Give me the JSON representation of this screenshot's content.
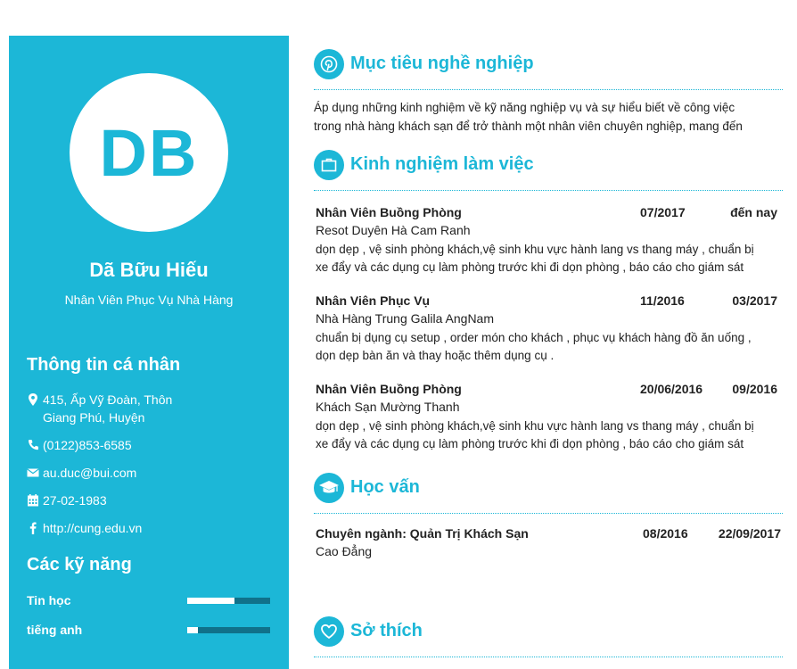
{
  "profile": {
    "initials": "DB",
    "name": "Dã Bữu Hiếu",
    "position": "Nhân Viên Phục Vụ Nhà Hàng"
  },
  "personal_info": {
    "heading": "Thông tin cá nhân",
    "address_line1": "415, Ấp Vỹ Đoàn, Thôn",
    "address_line2": "Giang Phú, Huyện",
    "phone": "(0122)853-6585",
    "email": "au.duc@bui.com",
    "birthday": "27-02-1983",
    "website": "http://cung.edu.vn"
  },
  "skills": {
    "heading": "Các kỹ năng",
    "items": [
      {
        "label": "Tin học",
        "level": 0.57
      },
      {
        "label": "tiếng anh",
        "level": 0.13
      }
    ]
  },
  "objective": {
    "title": "Mục tiêu nghề nghiệp",
    "line1": "Áp dụng những kinh nghiệm về kỹ năng nghiệp vụ và sự hiểu biết về công việc",
    "line2": "trong nhà hàng khách sạn để trở thành một nhân viên chuyên nghiệp, mang đến"
  },
  "experience": {
    "title": "Kinh nghiệm làm việc",
    "jobs": [
      {
        "title": "Nhân Viên Buồng Phòng",
        "from": "07/2017",
        "to": "đến nay",
        "place": "Resot Duyên Hà Cam Ranh",
        "desc1": "dọn dẹp , vệ sinh phòng khách,vệ sinh khu vực hành lang vs thang máy , chuẩn bị",
        "desc2": "xe đẩy và các dụng cụ làm phòng trước khi đi dọn phòng , báo cáo cho giám sát"
      },
      {
        "title": "Nhân Viên Phục Vụ",
        "from": "11/2016",
        "to": "03/2017",
        "place": "Nhà Hàng Trung Galila AngNam",
        "desc1": "chuẩn bị dụng cụ setup , order món cho khách , phục vụ khách hàng đồ ăn uống ,",
        "desc2": "dọn dẹp bàn ăn và thay hoặc thêm dụng cụ ."
      },
      {
        "title": "Nhân Viên Buồng Phòng",
        "from": "20/06/2016",
        "to": "09/2016",
        "place": "Khách Sạn Mường Thanh",
        "desc1": "dọn dẹp , vệ sinh phòng khách,vệ sinh khu vực hành lang vs thang máy , chuẩn bị",
        "desc2": "xe đẩy và các dụng cụ làm phòng trước khi đi dọn phòng , báo cáo cho giám sát"
      }
    ]
  },
  "education": {
    "title": "Học vấn",
    "major": "Chuyên ngành: Quản Trị Khách Sạn",
    "from": "08/2016",
    "to": "22/09/2017",
    "school": "Cao Đẳng"
  },
  "hobbies": {
    "title": "Sở thích"
  },
  "colors": {
    "accent": "#1cb7d7",
    "skill_track": "#10718a",
    "text": "#222222"
  },
  "icons": [
    "pinterest-icon",
    "briefcase-icon",
    "graduation-cap-icon",
    "heart-icon",
    "map-marker-icon",
    "phone-icon",
    "envelope-icon",
    "calendar-icon",
    "facebook-icon"
  ]
}
